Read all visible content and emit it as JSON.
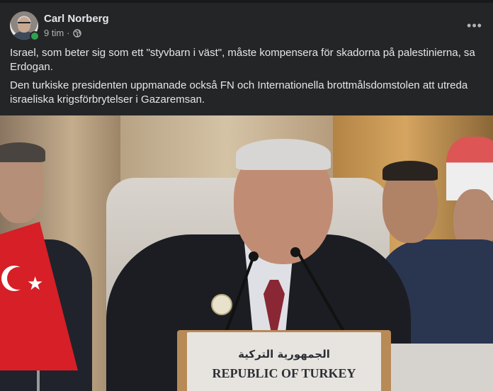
{
  "post": {
    "author": "Carl Norberg",
    "time": "9 tim",
    "separator": "·",
    "audience_icon": "globe-icon",
    "more_icon": "more-options-icon",
    "more_label": "•••",
    "paragraphs": [
      "Israel, som beter sig som ett \"styvbarn i väst\", måste kompensera för skadorna på palestinierna, sa Erdogan.",
      "Den turkiske presidenten uppmanade också FN och Internationella brottmålsdomstolen att utreda israeliska krigsförbrytelser i Gazaremsan."
    ]
  },
  "photo": {
    "placard_arabic": "الجمهورية التركية",
    "placard_latin": "REPUBLIC OF TURKEY"
  },
  "colors": {
    "background": "#242526",
    "text": "#e4e6eb",
    "secondary_text": "#b0b3b8",
    "online": "#31a24c"
  }
}
